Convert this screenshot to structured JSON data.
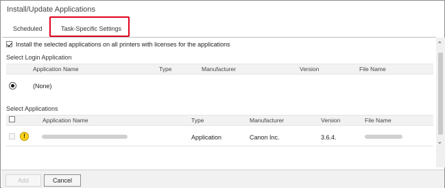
{
  "window": {
    "title": "Install/Update Applications"
  },
  "tabs": [
    {
      "label": "Scheduled"
    },
    {
      "label": "Task-Specific Settings"
    }
  ],
  "install_all": {
    "label": "Install the selected applications on all printers with licenses for the applications",
    "checked": true
  },
  "login_section": {
    "title": "Select Login Application",
    "columns": [
      "Application Name",
      "Type",
      "Manufacturer",
      "Version",
      "File Name"
    ],
    "rows": [
      {
        "name": "(None)",
        "selected": true
      }
    ]
  },
  "apps_section": {
    "title": "Select Applications",
    "columns": [
      "Application Name",
      "Type",
      "Manufacturer",
      "Version",
      "File Name"
    ],
    "rows": [
      {
        "name": "",
        "type": "Application",
        "manufacturer": "Canon Inc.",
        "version": "3.6.4.",
        "file_name": "",
        "status_icon": "warning-icon"
      }
    ]
  },
  "buttons": {
    "add": "Add",
    "cancel": "Cancel"
  },
  "colors": {
    "highlight": "#e0001b",
    "warning": "#ffd51a"
  }
}
